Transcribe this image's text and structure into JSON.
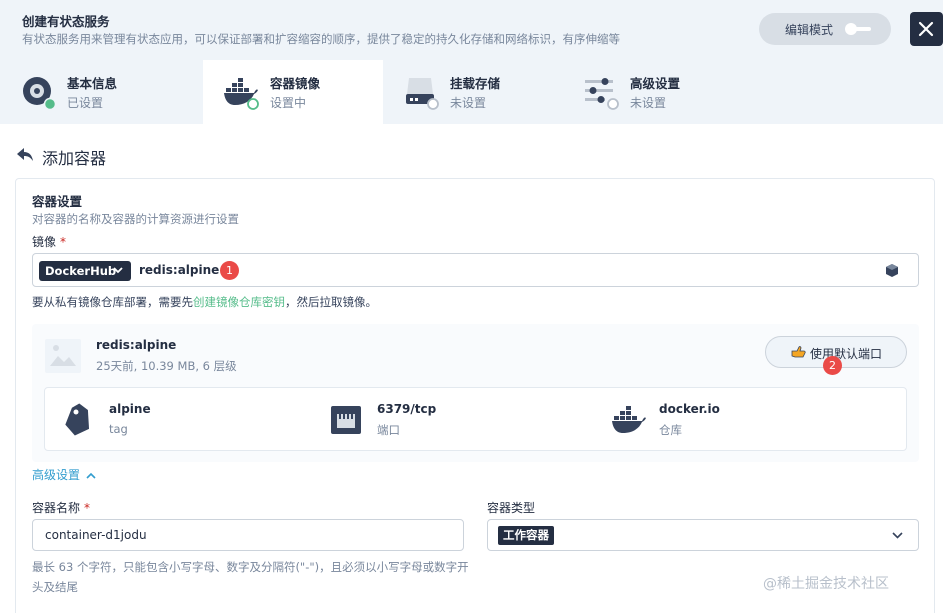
{
  "header": {
    "title": "创建有状态服务",
    "description": "有状态服务用来管理有状态应用，可以保证部署和扩容缩容的顺序，提供了稳定的持久化存储和网络标识，有序伸缩等",
    "edit_mode_label": "编辑模式"
  },
  "steps": [
    {
      "title": "基本信息",
      "status": "已设置",
      "icon": "info-icon"
    },
    {
      "title": "容器镜像",
      "status": "设置中",
      "icon": "docker-icon"
    },
    {
      "title": "挂载存储",
      "status": "未设置",
      "icon": "storage-icon"
    },
    {
      "title": "高级设置",
      "status": "未设置",
      "icon": "settings-icon"
    }
  ],
  "back_label": "添加容器",
  "container_settings": {
    "title": "容器设置",
    "description": "对容器的名称及容器的计算资源进行设置",
    "image_label": "镜像",
    "required_mark": "*",
    "registry": "DockerHub",
    "image_value": "redis:alpine",
    "hint_prefix": "要从私有镜像仓库部署，需要先",
    "hint_link": "创建镜像仓库密钥",
    "hint_suffix": "，然后拉取镜像。"
  },
  "annotations": {
    "badge1": "1",
    "badge2": "2"
  },
  "image_info": {
    "name": "redis:alpine",
    "meta": "25天前, 10.39 MB, 6 层级",
    "use_default_ports": "使用默认端口",
    "details": [
      {
        "value": "alpine",
        "label": "tag",
        "icon": "tag-icon"
      },
      {
        "value": "6379/tcp",
        "label": "端口",
        "icon": "port-icon"
      },
      {
        "value": "docker.io",
        "label": "仓库",
        "icon": "docker-icon"
      }
    ]
  },
  "advanced_label": "高级设置",
  "container_name": {
    "label": "容器名称",
    "required_mark": "*",
    "value": "container-d1jodu",
    "hint": "最长 63 个字符，只能包含小写字母、数字及分隔符(\"-\")，且必须以小写字母或数字开头及结尾"
  },
  "container_type": {
    "label": "容器类型",
    "value": "工作容器"
  },
  "watermark": "@稀土掘金技术社区",
  "colors": {
    "dark": "#242e42",
    "green": "#55bc8a",
    "blue": "#329dce",
    "red": "#ea4a47",
    "bg": "#eff4f9"
  }
}
